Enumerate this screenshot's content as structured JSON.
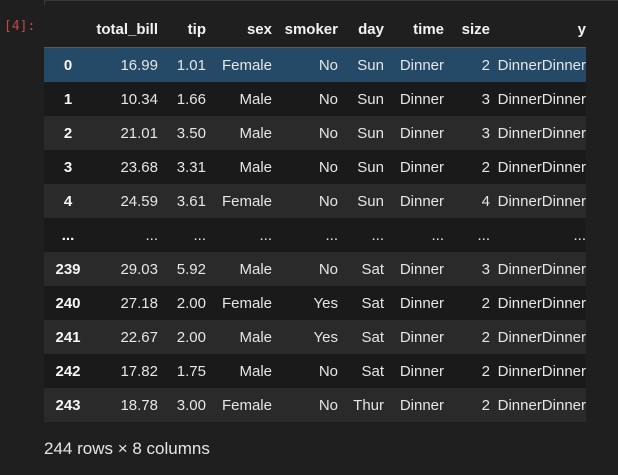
{
  "cell": {
    "execution_count": "[4]:"
  },
  "table": {
    "columns": [
      "total_bill",
      "tip",
      "sex",
      "smoker",
      "day",
      "time",
      "size",
      "y"
    ],
    "rows": [
      {
        "index": "0",
        "values": [
          "16.99",
          "1.01",
          "Female",
          "No",
          "Sun",
          "Dinner",
          "2",
          "DinnerDinner"
        ]
      },
      {
        "index": "1",
        "values": [
          "10.34",
          "1.66",
          "Male",
          "No",
          "Sun",
          "Dinner",
          "3",
          "DinnerDinner"
        ]
      },
      {
        "index": "2",
        "values": [
          "21.01",
          "3.50",
          "Male",
          "No",
          "Sun",
          "Dinner",
          "3",
          "DinnerDinner"
        ]
      },
      {
        "index": "3",
        "values": [
          "23.68",
          "3.31",
          "Male",
          "No",
          "Sun",
          "Dinner",
          "2",
          "DinnerDinner"
        ]
      },
      {
        "index": "4",
        "values": [
          "24.59",
          "3.61",
          "Female",
          "No",
          "Sun",
          "Dinner",
          "4",
          "DinnerDinner"
        ]
      },
      {
        "index": "...",
        "values": [
          "...",
          "...",
          "...",
          "...",
          "...",
          "...",
          "...",
          "..."
        ]
      },
      {
        "index": "239",
        "values": [
          "29.03",
          "5.92",
          "Male",
          "No",
          "Sat",
          "Dinner",
          "3",
          "DinnerDinner"
        ]
      },
      {
        "index": "240",
        "values": [
          "27.18",
          "2.00",
          "Female",
          "Yes",
          "Sat",
          "Dinner",
          "2",
          "DinnerDinner"
        ]
      },
      {
        "index": "241",
        "values": [
          "22.67",
          "2.00",
          "Male",
          "Yes",
          "Sat",
          "Dinner",
          "2",
          "DinnerDinner"
        ]
      },
      {
        "index": "242",
        "values": [
          "17.82",
          "1.75",
          "Male",
          "No",
          "Sat",
          "Dinner",
          "2",
          "DinnerDinner"
        ]
      },
      {
        "index": "243",
        "values": [
          "18.78",
          "3.00",
          "Female",
          "No",
          "Thur",
          "Dinner",
          "2",
          "DinnerDinner"
        ]
      }
    ],
    "highlighted_row": "0"
  },
  "summary": "244 rows × 8 columns",
  "colors": {
    "background": "#1f1f1f",
    "row_odd": "#2a2a2a",
    "row_even": "#1a1a1a",
    "row_highlight": "#244a68",
    "execution_count": "#c04848"
  }
}
